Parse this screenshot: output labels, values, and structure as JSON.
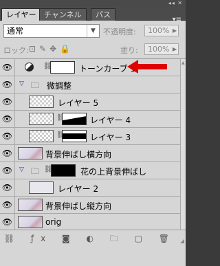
{
  "window": {
    "controls": "◂◂ ✕"
  },
  "tabs": [
    {
      "label": "レイヤー",
      "active": true
    },
    {
      "label": "チャンネル",
      "active": false
    },
    {
      "label": "パス",
      "active": false
    }
  ],
  "panel_menu_icon": "panel-menu-icon",
  "blend_mode": {
    "value": "通常"
  },
  "opacity": {
    "label": "不透明度:",
    "value": "100%"
  },
  "lock": {
    "label": "ロック:"
  },
  "fill": {
    "label": "塗り:",
    "value": "100%"
  },
  "layers": [
    {
      "name": "トーンカーブ 1",
      "kind": "adjustment",
      "indent": 0
    },
    {
      "name": "微調整",
      "kind": "group",
      "indent": 0
    },
    {
      "name": "レイヤー 5",
      "kind": "pixel",
      "indent": 1
    },
    {
      "name": "レイヤー 4",
      "kind": "pixel-mask",
      "indent": 1
    },
    {
      "name": "レイヤー 3",
      "kind": "pixel-mask",
      "indent": 1
    },
    {
      "name": "背景伸ばし横方向",
      "kind": "photo",
      "indent": 0
    },
    {
      "name": "花の上背景伸ばし",
      "kind": "group-mask",
      "indent": 0
    },
    {
      "name": "レイヤー 2",
      "kind": "pixel",
      "indent": 1
    },
    {
      "name": "背景伸ばし縦方向",
      "kind": "photo",
      "indent": 0
    },
    {
      "name": "orig",
      "kind": "photo",
      "indent": 0
    }
  ],
  "footer_icons": [
    "link-layers-icon",
    "fx-icon",
    "add-mask-icon",
    "adjustment-layer-icon",
    "new-group-icon",
    "new-layer-icon",
    "trash-icon"
  ],
  "annotation_color": "#e00000"
}
